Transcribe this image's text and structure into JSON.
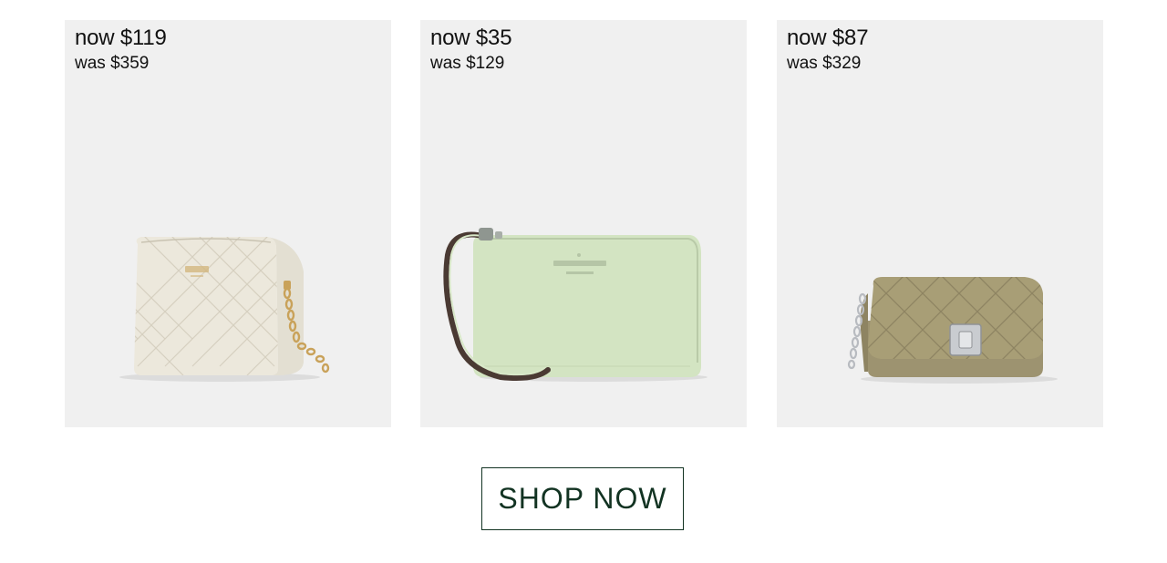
{
  "products": [
    {
      "price_now": "now $119",
      "price_was": "was $359",
      "image": "cream-quilted-crossbody-bag",
      "brand_mark": "kate spade",
      "colors": {
        "bag": "#ece8dc",
        "hardware": "#c9a25a"
      }
    },
    {
      "price_now": "now $35",
      "price_was": "was $129",
      "image": "mint-leather-wristlet",
      "brand_mark": "kate spade",
      "brand_sub": "NEW YORK",
      "colors": {
        "bag": "#d3e4c2",
        "strap": "#4a3a33"
      }
    },
    {
      "price_now": "now $87",
      "price_was": "was $329",
      "image": "olive-quilted-flap-bag",
      "colors": {
        "bag": "#a89e76",
        "hardware": "#c9ccd0"
      }
    }
  ],
  "cta": {
    "label": "SHOP NOW",
    "color": "#123322"
  },
  "colors": {
    "card_bg": "#f0f0f0",
    "page_bg": "#ffffff",
    "text": "#111111"
  }
}
